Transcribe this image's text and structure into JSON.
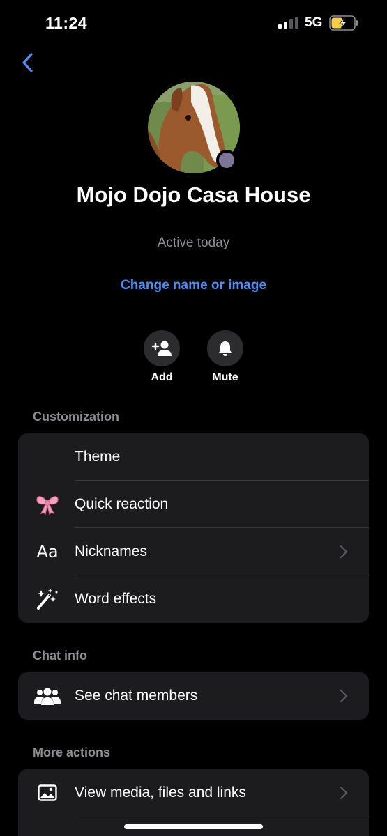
{
  "status": {
    "time": "11:24",
    "network": "5G"
  },
  "profile": {
    "name": "Mojo Dojo Casa House",
    "status": "Active today",
    "change_link": "Change name or image"
  },
  "actions": [
    {
      "label": "Add",
      "icon": "add-person-icon"
    },
    {
      "label": "Mute",
      "icon": "bell-icon"
    }
  ],
  "customization": {
    "title": "Customization",
    "items": [
      {
        "label": "Theme",
        "icon": "theme-icon"
      },
      {
        "label": "Quick reaction",
        "icon": "bow-emoji-icon"
      },
      {
        "label": "Nicknames",
        "icon": "text-aa-icon",
        "icon_text": "Aa"
      },
      {
        "label": "Word effects",
        "icon": "magic-wand-icon"
      }
    ]
  },
  "chat_info": {
    "title": "Chat info",
    "items": [
      {
        "label": "See chat members",
        "icon": "group-icon"
      }
    ]
  },
  "more_actions": {
    "title": "More actions",
    "items": [
      {
        "label": "View media, files and links",
        "icon": "image-icon"
      }
    ]
  },
  "colors": {
    "accent": "#4f8ef7",
    "background": "#000000",
    "card": "#1c1c1e",
    "presence": "#7d7597"
  }
}
